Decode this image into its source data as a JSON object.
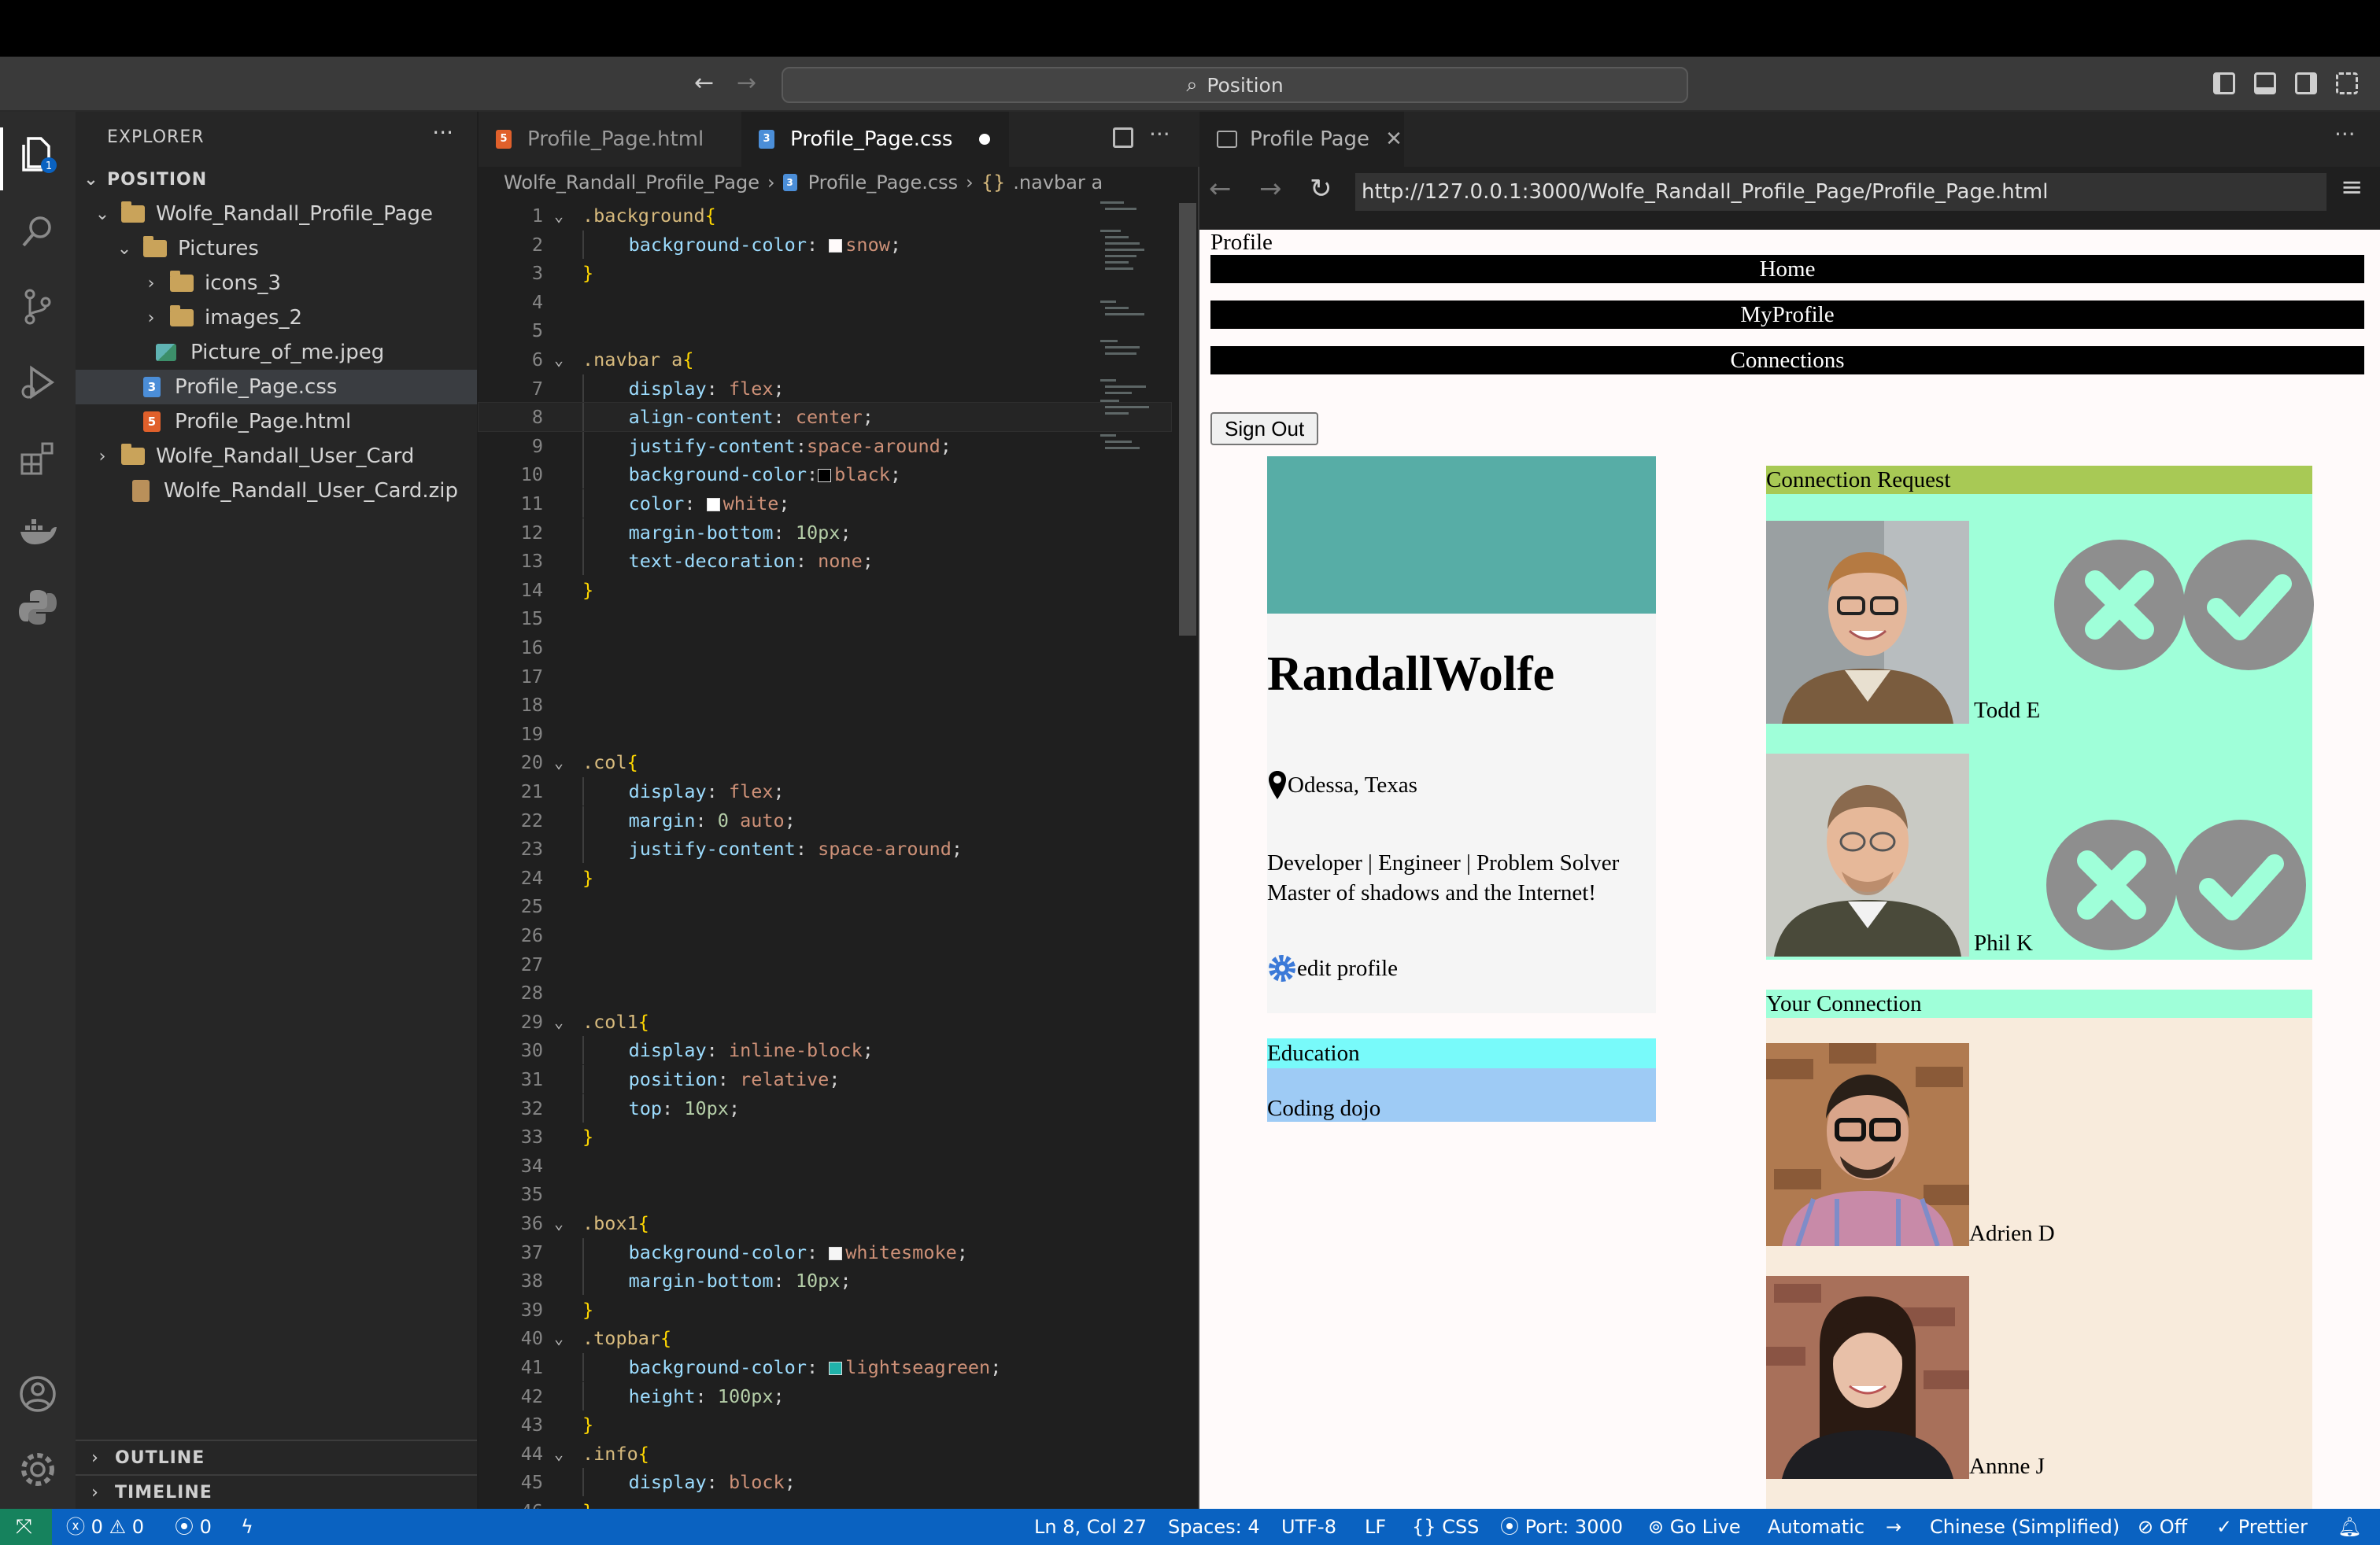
{
  "titlebar": {
    "search": "Position"
  },
  "explorer": {
    "header": "EXPLORER",
    "root": "POSITION",
    "tree": [
      {
        "label": "Wolfe_Randall_Profile_Page",
        "kind": "folder",
        "open": true
      },
      {
        "label": "Pictures",
        "kind": "folder",
        "open": true
      },
      {
        "label": "icons_3",
        "kind": "folder",
        "open": false
      },
      {
        "label": "images_2",
        "kind": "folder",
        "open": false
      },
      {
        "label": "Picture_of_me.jpeg",
        "kind": "image"
      },
      {
        "label": "Profile_Page.css",
        "kind": "css",
        "selected": true
      },
      {
        "label": "Profile_Page.html",
        "kind": "html"
      },
      {
        "label": "Wolfe_Randall_User_Card",
        "kind": "folder",
        "open": false
      },
      {
        "label": "Wolfe_Randall_User_Card.zip",
        "kind": "zip"
      }
    ],
    "outline": "OUTLINE",
    "timeline": "TIMELINE"
  },
  "editor": {
    "tabs": [
      {
        "label": "Profile_Page.html",
        "kind": "html"
      },
      {
        "label": "Profile_Page.css",
        "kind": "css",
        "active": true,
        "dirty": true
      }
    ],
    "breadcrumb": [
      "Wolfe_Randall_Profile_Page",
      "Profile_Page.css",
      ".navbar a"
    ],
    "lines": [
      ".background{",
      "    background-color: snow;",
      "}",
      "",
      "",
      ".navbar a{",
      "    display: flex;",
      "    align-content: center;",
      "    justify-content:space-around;",
      "    background-color:black;",
      "    color: white;",
      "    margin-bottom: 10px;",
      "    text-decoration: none;",
      "}",
      "",
      "",
      "",
      "",
      "",
      ".col{",
      "    display: flex;",
      "    margin: 0 auto;",
      "    justify-content: space-around;",
      "}",
      "",
      "",
      "",
      "",
      ".col1{",
      "    display: inline-block;",
      "    position: relative;",
      "    top: 10px;",
      "}",
      "",
      "",
      ".box1{",
      "    background-color: whitesmoke;",
      "    margin-bottom: 10px;",
      "}",
      ".topbar{",
      "    background-color: lightseagreen;",
      "    height: 100px;",
      "}",
      ".info{",
      "    display: block;",
      "}"
    ]
  },
  "browser": {
    "tab": "Profile Page",
    "url": "http://127.0.0.1:3000/Wolfe_Randall_Profile_Page/Profile_Page.html",
    "page": {
      "heading": "Profile",
      "nav": [
        "Home",
        "MyProfile",
        "Connections"
      ],
      "signout": "Sign Out",
      "name": "RandallWolfe",
      "location": "Odessa, Texas",
      "bio_line1": "Developer | Engineer | Problem Solver",
      "bio_line2": "Master of shadows and the Internet!",
      "edit": "edit profile",
      "education_title": "Education",
      "education_item": "Coding dojo",
      "requests_title": "Connection Request",
      "requests": [
        "Todd E",
        "Phil K"
      ],
      "connections_title": "Your Connection",
      "connections": [
        "Adrien D",
        "Annne J"
      ]
    }
  },
  "statusbar": {
    "errors": "0",
    "warnings": "0",
    "ports": "0",
    "cursor": "Ln 8, Col 27",
    "spaces": "Spaces: 4",
    "encoding": "UTF-8",
    "eol": "LF",
    "language": "CSS",
    "port": "Port: 3000",
    "golive": "Go Live",
    "automatic": "Automatic",
    "locale": "Chinese (Simplified)",
    "off": "Off",
    "prettier": "Prettier"
  },
  "colors": {
    "accent": "#0a62c1",
    "topbar": "#57ada6",
    "request_bg": "#9fffd9",
    "request_head": "#a8c955",
    "edu_head": "#78fafa",
    "edu_body": "#9ecbf5",
    "conn_bg": "#f8ebdc"
  }
}
